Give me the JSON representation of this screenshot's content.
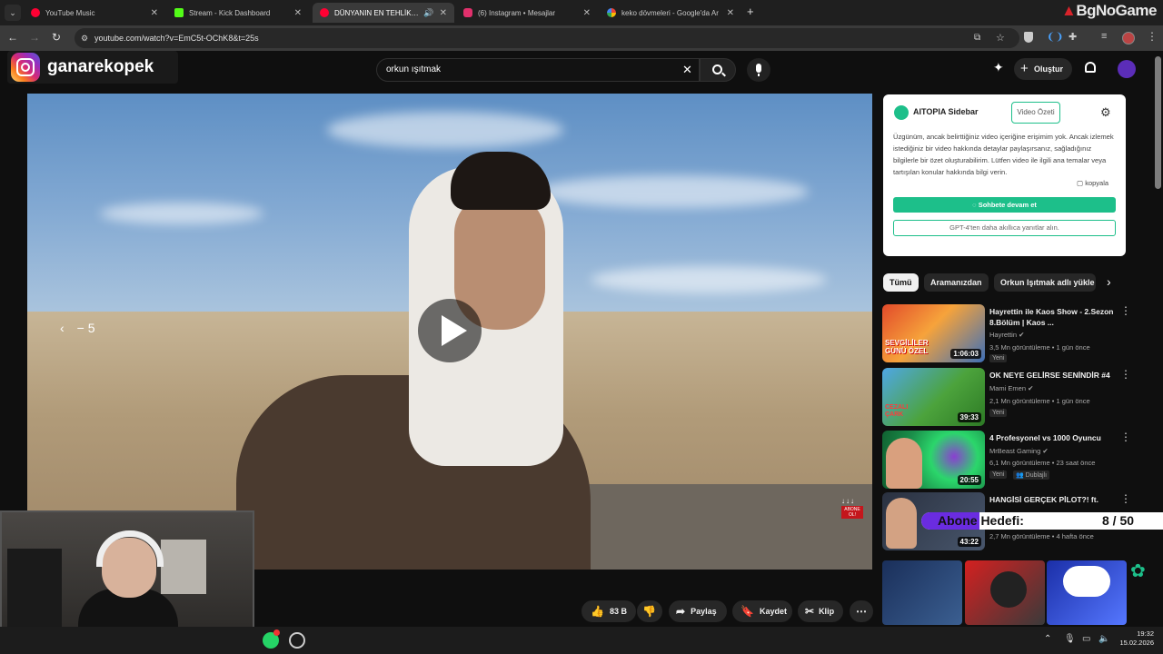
{
  "tabs": [
    {
      "title": "YouTube Music",
      "color": "#ff0033"
    },
    {
      "title": "Stream - Kick Dashboard",
      "color": "#53fc18"
    },
    {
      "title": "DÜNYANIN EN TEHLİKELİ TE",
      "color": "#ff0033"
    },
    {
      "title": "(6) Instagram • Mesajlar",
      "color": "#e1306c"
    },
    {
      "title": "keko dövmeleri - Google'da Ar",
      "color": "#4285f4"
    }
  ],
  "watermark": "BgNoGame",
  "address": {
    "url": "youtube.com/watch?v=EmC5t-OChK8&t=25s"
  },
  "overlay_handle": "ganarekopek",
  "youtube": {
    "search_query": "orkun ışıtmak",
    "create_label": "Oluştur"
  },
  "player": {
    "seek_back": "− 5",
    "corner_label": "ABONE OL!"
  },
  "actions": {
    "likes": "83 B",
    "share": "Paylaş",
    "save": "Kaydet",
    "clip": "Klip"
  },
  "aitopia": {
    "title": "AITOPIA Sidebar",
    "summary_button": "Video Özeti",
    "message": "Üzgünüm, ancak belirttiğiniz video içeriğine erişimim yok. Ancak izlemek istediğiniz bir video hakkında detaylar paylaşırsanız, sağladığınız bilgilerle bir özet oluşturabilirim. Lütfen video ile ilgili ana temalar veya tartışılan konular hakkında bilgi verin.",
    "copy_label": "kopyala",
    "continue_button": "Sohbete devam et",
    "gpt4_button": "GPT-4'ten daha akıllıca yanıtlar alın.",
    "accent": "#1dbf8a"
  },
  "chips": [
    "Tümü",
    "Aramanızdan",
    "Orkun Işıtmak adlı yükle"
  ],
  "recommended": [
    {
      "title": "Hayrettin ile Kaos Show - 2.Sezon 8.Bölüm | Kaos ...",
      "channel": "Hayrettin",
      "meta": "3,5 Mn görüntüleme • 1 gün önce",
      "badge": "Yeni",
      "duration": "1:06:03",
      "thumb_text": "SEVGİLİLER GÜNÜ ÖZEL"
    },
    {
      "title": "OK NEYE GELİRSE SENİNDİR #4",
      "channel": "Mami Emen",
      "meta": "2,1 Mn görüntüleme • 1 gün önce",
      "badge": "Yeni",
      "duration": "39:33",
      "thumb_text": "CEZALI ÇARK"
    },
    {
      "title": "4 Profesyonel vs 1000 Oyuncu",
      "channel": "MrBeast Gaming",
      "meta": "6,1 Mn görüntüleme • 23 saat önce",
      "badge": "Yeni",
      "badge2": "Dublajlı",
      "duration": "20:55",
      "thumb_text": ""
    },
    {
      "title": "HANGİSİ GERÇEK PİLOT?! ft.",
      "channel": "",
      "meta": "2,7 Mn görüntüleme • 4 hafta önce",
      "badge": "",
      "duration": "43:22",
      "thumb_text": ""
    }
  ],
  "goal": {
    "label": "Abone Hedefi:",
    "value": "8 / 50"
  },
  "taskbar": {
    "time": "19:32",
    "date": "15.02.2026"
  }
}
